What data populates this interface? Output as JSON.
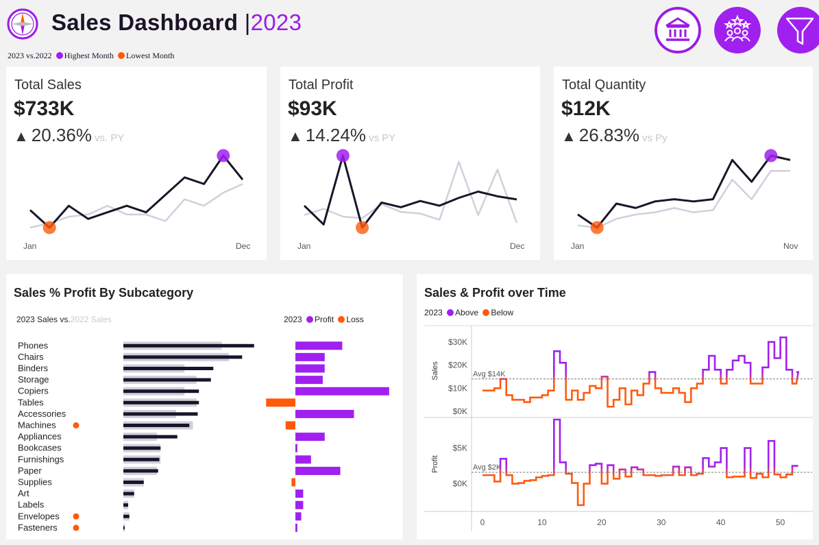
{
  "header": {
    "title": "Sales Dashboard ",
    "separator": "|",
    "year": "2023",
    "legend": {
      "compare": "2023 vs.2022",
      "highest": "Highest Month",
      "lowest": "Lowest Month"
    },
    "icons": [
      "bank-icon",
      "team-rating-icon",
      "filter-icon"
    ],
    "colors": {
      "accent": "#9b1be6",
      "highlight": "#a020f0",
      "low": "#ff5a0a",
      "dark": "#1b1428",
      "prior": "#d0d0dc"
    }
  },
  "kpis": [
    {
      "label": "Total Sales",
      "value": "$733K",
      "change": "20.36%",
      "vs": "vs. PY",
      "start_tick": "Jan",
      "end_tick": "Dec"
    },
    {
      "label": "Total Profit",
      "value": "$93K",
      "change": "14.24%",
      "vs": "vs PY",
      "start_tick": "Jan",
      "end_tick": "Dec"
    },
    {
      "label": "Total Quantity",
      "value": "$12K",
      "change": "26.83%",
      "vs": "vs Py",
      "start_tick": "Jan",
      "end_tick": "Nov"
    }
  ],
  "chart_data": [
    {
      "type": "line",
      "name": "kpi-sales-spark",
      "series": [
        {
          "name": "2023",
          "values": [
            3.8,
            3.0,
            4.0,
            3.4,
            3.7,
            4.0,
            3.7,
            4.5,
            5.3,
            5.0,
            6.3,
            5.2
          ]
        },
        {
          "name": "2022",
          "values": [
            3.0,
            3.2,
            3.5,
            3.6,
            4.0,
            3.6,
            3.6,
            3.3,
            4.3,
            4.0,
            4.6,
            5.0
          ]
        }
      ],
      "highest_index": 10,
      "lowest_index": 1
    },
    {
      "type": "line",
      "name": "kpi-profit-spark",
      "series": [
        {
          "name": "2023",
          "values": [
            4.0,
            2.8,
            7.2,
            2.6,
            4.2,
            3.9,
            4.3,
            4.0,
            4.5,
            4.9,
            4.6,
            4.4
          ]
        },
        {
          "name": "2022",
          "values": [
            3.4,
            3.8,
            3.3,
            3.2,
            4.1,
            3.6,
            3.5,
            3.1,
            6.8,
            3.4,
            6.3,
            2.9
          ]
        }
      ],
      "highest_index": 2,
      "lowest_index": 3
    },
    {
      "type": "line",
      "name": "kpi-quantity-spark",
      "series": [
        {
          "name": "2023",
          "values": [
            3.3,
            2.7,
            3.8,
            3.6,
            3.9,
            4.0,
            3.9,
            4.0,
            5.8,
            4.8,
            6.0,
            5.8
          ]
        },
        {
          "name": "2022",
          "values": [
            2.8,
            2.7,
            3.1,
            3.3,
            3.4,
            3.6,
            3.4,
            3.5,
            4.9,
            4.0,
            5.3,
            5.3
          ]
        }
      ],
      "highest_index": 10,
      "lowest_index": 1
    },
    {
      "type": "bar",
      "title": "Sales % Profit By Subcategory",
      "categories": [
        "Phones",
        "Chairs",
        "Binders",
        "Storage",
        "Copiers",
        "Tables",
        "Accessories",
        "Machines",
        "Appliances",
        "Bookcases",
        "Furnishings",
        "Paper",
        "Supplies",
        "Art",
        "Labels",
        "Envelopes",
        "Fasteners"
      ],
      "flagged": [
        "Machines",
        "Envelopes",
        "Fasteners"
      ],
      "series": [
        {
          "name": "2023 Sales",
          "values": [
            109,
            99,
            75,
            73,
            63,
            63,
            62,
            55,
            45,
            31,
            30,
            29,
            17,
            9,
            4,
            5,
            1
          ]
        },
        {
          "name": "2022 Sales",
          "values": [
            82,
            88,
            51,
            61,
            51,
            61,
            44,
            58,
            28,
            31,
            31,
            28,
            17,
            9,
            4,
            5,
            1
          ]
        },
        {
          "name": "Profit",
          "values": [
            24,
            15,
            15,
            14,
            48,
            -15,
            30,
            -5,
            15,
            1,
            8,
            23,
            -2,
            4,
            4,
            3,
            1
          ]
        }
      ],
      "legend_sales": {
        "current": "2023 Sales vs.",
        "prior": "2022 Sales"
      },
      "legend_profit": {
        "year": "2023",
        "profit": "Profit",
        "loss": "Loss"
      }
    },
    {
      "type": "line",
      "title": "Sales & Profit over Time",
      "legend": {
        "year": "2023",
        "above": "Above",
        "below": "Below"
      },
      "xlim": [
        0,
        52
      ],
      "x_ticks": [
        0,
        10,
        20,
        30,
        40,
        50
      ],
      "sales": {
        "ylabel": "Sales",
        "y_ticks": [
          "$0K",
          "$10K",
          "$20K",
          "$30K"
        ],
        "ylim": [
          0,
          35
        ],
        "avg": 14,
        "avg_label": "Avg $14K",
        "values": [
          9,
          9,
          10,
          14,
          7,
          5,
          5,
          4,
          6,
          6,
          7,
          9,
          26,
          21,
          5,
          9,
          5,
          8,
          11,
          10,
          15,
          2,
          5,
          10,
          3,
          9,
          7,
          12,
          17,
          10,
          8,
          8,
          10,
          8,
          4,
          10,
          12,
          18,
          24,
          18,
          12,
          18,
          22,
          24,
          21,
          12,
          12,
          19,
          30,
          23,
          32,
          18,
          12,
          17
        ]
      },
      "profit": {
        "ylabel": "Profit",
        "y_ticks": [
          "$0K",
          "$5K"
        ],
        "ylim": [
          -3.5,
          9
        ],
        "avg": 1.6,
        "avg_label": "Avg $2K",
        "values": [
          1.2,
          1.2,
          0.3,
          3.5,
          1.2,
          0.0,
          0.1,
          0.4,
          0.5,
          0.9,
          1.1,
          1.2,
          9.0,
          3.0,
          1.4,
          0.1,
          -3.0,
          0.0,
          2.6,
          2.8,
          0.0,
          2.6,
          0.7,
          2.0,
          1.0,
          2.3,
          2.0,
          1.2,
          1.2,
          1.1,
          1.2,
          1.2,
          2.4,
          1.2,
          2.3,
          1.2,
          1.4,
          3.6,
          2.4,
          3.0,
          5.0,
          0.9,
          1.0,
          1.0,
          5.0,
          0.8,
          1.4,
          0.9,
          6.0,
          1.3,
          0.9,
          1.3,
          2.5,
          2.5
        ]
      }
    }
  ],
  "x_axis_ticks": [
    "0",
    "10",
    "20",
    "30",
    "40",
    "50"
  ]
}
